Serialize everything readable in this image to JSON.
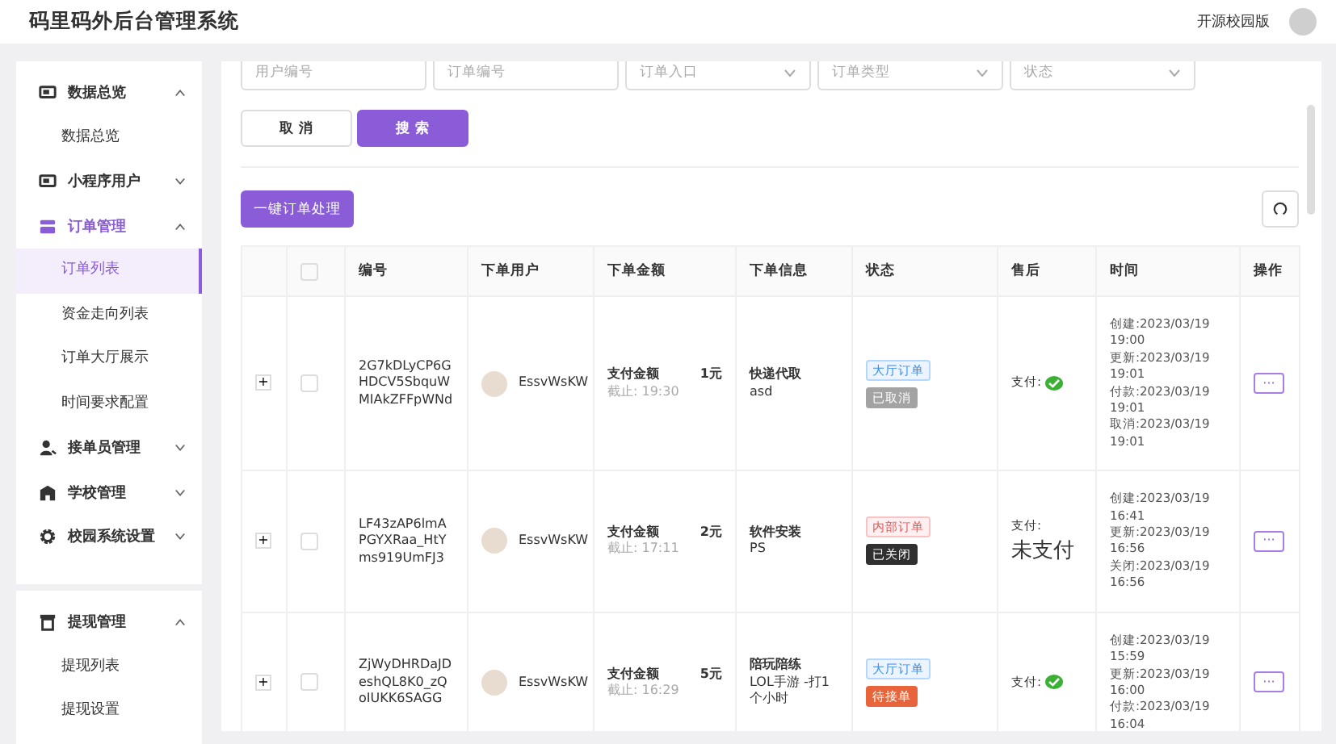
{
  "header": {
    "title": "码里码外后台管理系统",
    "edition": "开源校园版"
  },
  "sidebar": {
    "sections": [
      {
        "groups": [
          {
            "label": "数据总览",
            "expanded": true,
            "children": [
              {
                "label": "数据总览",
                "selected": false
              }
            ]
          },
          {
            "label": "小程序用户",
            "expanded": false
          },
          {
            "label": "订单管理",
            "expanded": true,
            "children": [
              {
                "label": "订单列表",
                "selected": true
              },
              {
                "label": "资金走向列表",
                "selected": false
              },
              {
                "label": "订单大厅展示",
                "selected": false
              },
              {
                "label": "时间要求配置",
                "selected": false
              }
            ]
          },
          {
            "label": "接单员管理",
            "expanded": false
          },
          {
            "label": "学校管理",
            "expanded": false
          },
          {
            "label": "校园系统设置",
            "expanded": false
          }
        ]
      },
      {
        "groups": [
          {
            "label": "提现管理",
            "expanded": true,
            "children": [
              {
                "label": "提现列表",
                "selected": false
              },
              {
                "label": "提现设置",
                "selected": false
              }
            ]
          }
        ]
      }
    ]
  },
  "filters": [
    {
      "placeholder": "用户编号",
      "kind": "text"
    },
    {
      "placeholder": "订单编号",
      "kind": "text"
    },
    {
      "placeholder": "订单入口",
      "kind": "select"
    },
    {
      "placeholder": "订单类型",
      "kind": "select"
    },
    {
      "placeholder": "状态",
      "kind": "select"
    }
  ],
  "form_buttons": [
    {
      "label": "取 消",
      "kind": "plain"
    },
    {
      "label": "搜 索",
      "kind": "primary"
    }
  ],
  "batch_button": "一键订单处理",
  "table": {
    "all_checked": false,
    "columns": [
      "编号",
      "下单用户",
      "下单金额",
      "下单信息",
      "状态",
      "售后",
      "时间",
      "操作"
    ],
    "rows": [
      {
        "expand": "+",
        "checked": false,
        "id": "2G7kDLyCP6GHDCV5SbquWMIAkZFFpWNd",
        "user": "EssvWsKW",
        "amount_label": "支付金额",
        "amount": "1元",
        "deadline": "截止: 19:30",
        "info_title": "快递代取",
        "info_detail": "asd",
        "entry": {
          "label": "大厅订单",
          "kind": "hall"
        },
        "status": {
          "label": "已取消",
          "kind": "cancelled"
        },
        "payment_label": "支付:",
        "payment": {
          "kind": "icon"
        },
        "times": [
          "创建:2023/03/19 19:00",
          "更新:2023/03/19 19:01",
          "付款:2023/03/19 19:01",
          "取消:2023/03/19 19:01"
        ],
        "action": "···"
      },
      {
        "expand": "+",
        "checked": false,
        "id": "LF43zAP6lmAPGYXRaa_HtYms919UmFJ3",
        "user": "EssvWsKW",
        "amount_label": "支付金额",
        "amount": "2元",
        "deadline": "截止: 17:11",
        "info_title": "软件安装",
        "info_detail": "PS",
        "entry": {
          "label": "内部订单",
          "kind": "internal"
        },
        "status": {
          "label": "已关闭",
          "kind": "closed"
        },
        "payment_label": "支付:",
        "payment": {
          "kind": "text",
          "text": "未支付"
        },
        "times": [
          "创建:2023/03/19 16:41",
          "更新:2023/03/19 16:56",
          "关闭:2023/03/19 16:56"
        ],
        "action": "···"
      },
      {
        "expand": "+",
        "checked": false,
        "id": "ZjWyDHRDaJDeshQL8K0_zQoIUKK6SAGG",
        "user": "EssvWsKW",
        "amount_label": "支付金额",
        "amount": "5元",
        "deadline": "截止: 16:29",
        "info_title": "陪玩陪练",
        "info_detail": "LOL手游 -打1个小时",
        "entry": {
          "label": "大厅订单",
          "kind": "hall"
        },
        "status": {
          "label": "待接单",
          "kind": "pending"
        },
        "payment_label": "支付:",
        "payment": {
          "kind": "icon"
        },
        "times": [
          "创建:2023/03/19 15:59",
          "更新:2023/03/19 16:00",
          "付款:2023/03/19 16:04"
        ],
        "action": "···"
      }
    ]
  }
}
